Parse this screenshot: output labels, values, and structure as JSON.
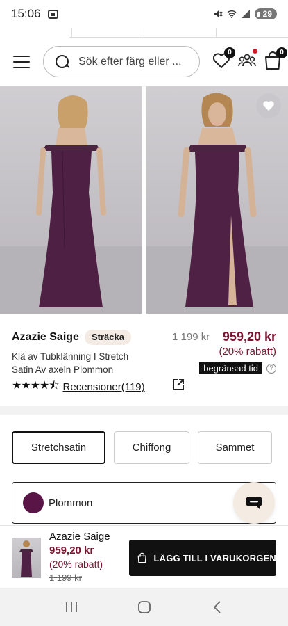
{
  "status_bar": {
    "time": "15:06",
    "battery": "29"
  },
  "header": {
    "search_placeholder": "Sök efter färg eller ...",
    "wishlist_count": "0",
    "cart_count": "0"
  },
  "product": {
    "name": "Azazie Saige",
    "tag": "Stretch",
    "tag_label": "Sträcka",
    "description": "Klä av Tubklänning I Stretch Satin Av axeln Plommon",
    "old_price": "1 199 kr",
    "price": "959,20 kr",
    "discount": "(20% rabatt)",
    "limited_label": "begränsad tid",
    "help_glyph": "?",
    "stars": "★★★★⯪",
    "reviews_label": "Recensioner(119)"
  },
  "materials": [
    {
      "label": "Stretchsatin",
      "active": true
    },
    {
      "label": "Chiffong",
      "active": false
    },
    {
      "label": "Sammet",
      "active": false
    }
  ],
  "color": {
    "name": "Plommon",
    "hex": "#5a1547"
  },
  "sticky": {
    "name": "Azazie Saige",
    "price": "959,20 kr",
    "discount": "(20% rabatt)",
    "old_price": "1 199 kr",
    "add_to_cart": "LÄGG TILL I VARUKORGEN"
  },
  "colors": {
    "accent_price": "#7a1631",
    "badge_bg": "#f3ebe4",
    "button_dark": "#111111"
  }
}
